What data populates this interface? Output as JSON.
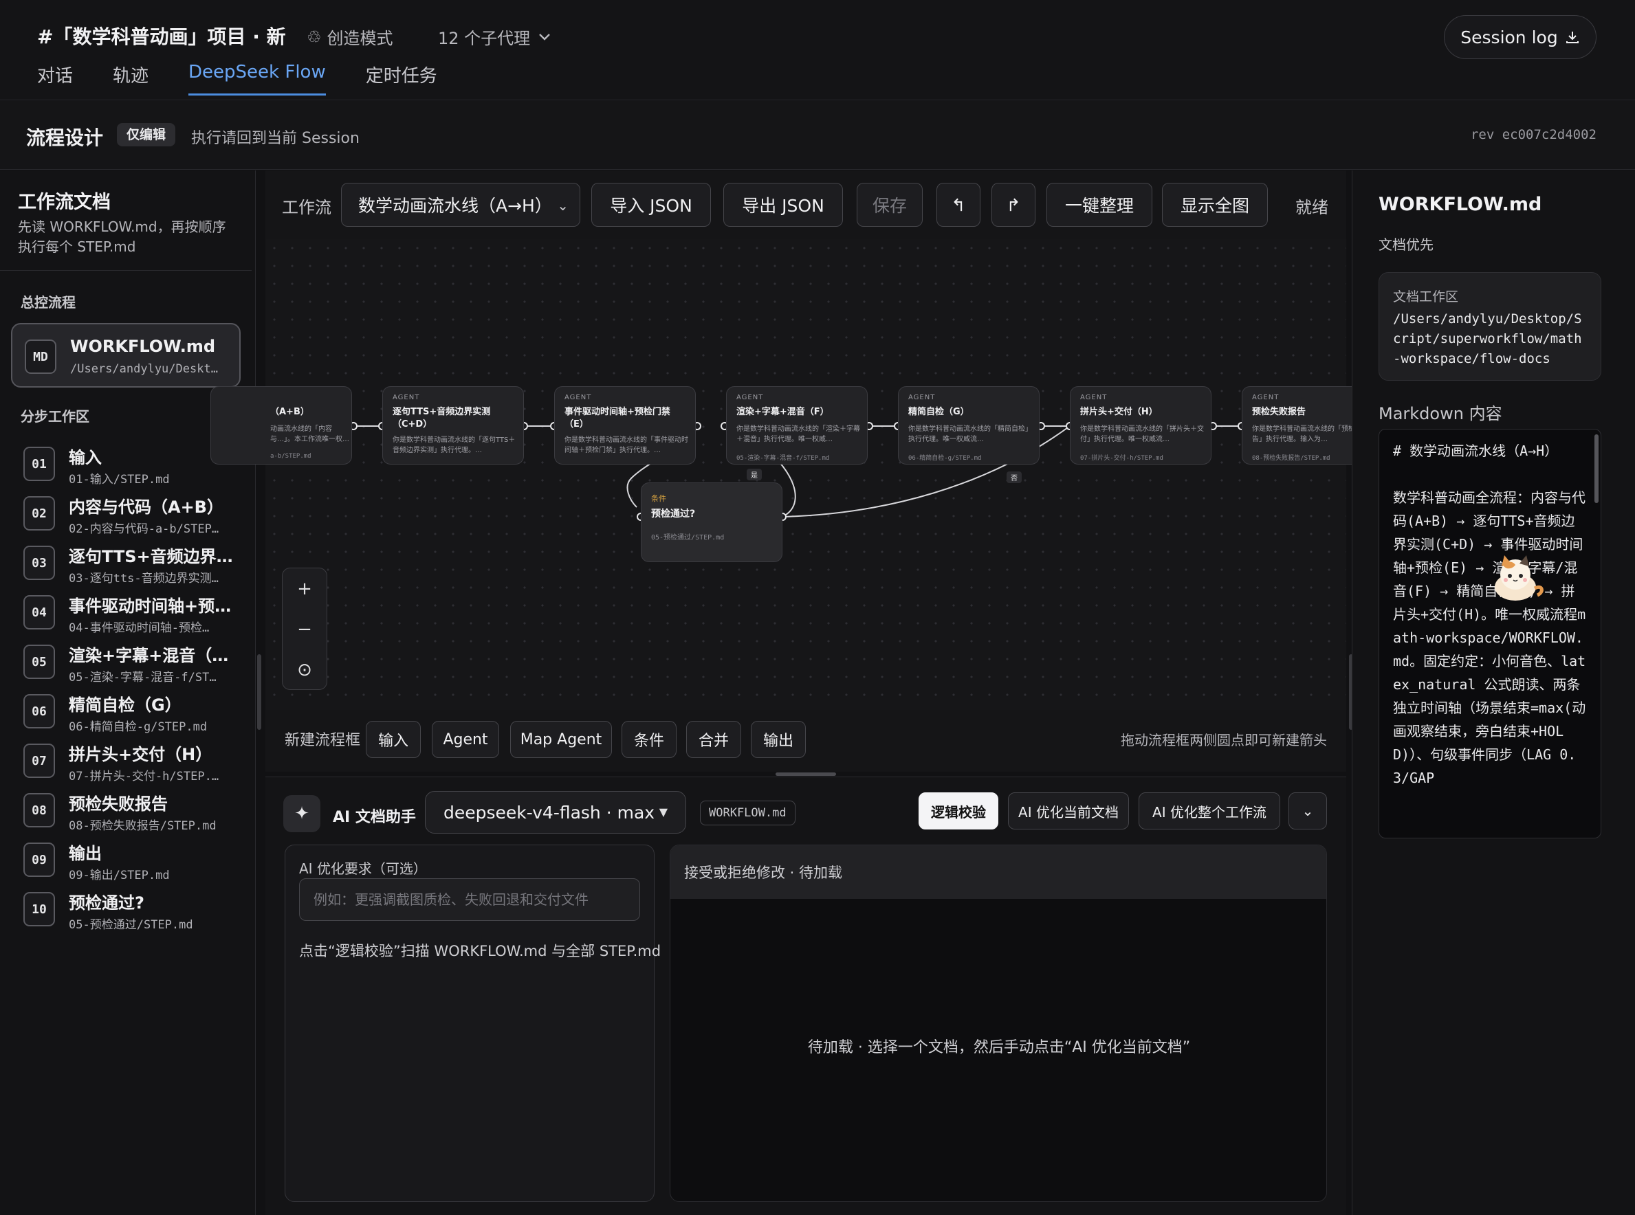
{
  "header": {
    "project_title": "#「数学科普动画」项目 · 新",
    "mode": "创造模式",
    "agents": "12 个子代理",
    "session_log": "Session log",
    "tabs": [
      {
        "label": "对话",
        "active": false
      },
      {
        "label": "轨迹",
        "active": false
      },
      {
        "label": "DeepSeek Flow",
        "active": true
      },
      {
        "label": "定时任务",
        "active": false
      }
    ]
  },
  "subheader": {
    "title": "流程设计",
    "badge": "仅编辑",
    "hint": "执行请回到当前 Session",
    "rev": "rev ec007c2d4002"
  },
  "sidebar": {
    "title": "工作流文档",
    "desc": "先读 WORKFLOW.md，再按顺序执行每个 STEP.md",
    "section_main": "总控流程",
    "main_item": {
      "badge": "MD",
      "name": "WORKFLOW.md",
      "path": "/Users/andylyu/Deskt…"
    },
    "section_steps": "分步工作区",
    "items": [
      {
        "num": "01",
        "name": "输入",
        "path": "01-输入/STEP.md"
      },
      {
        "num": "02",
        "name": "内容与代码（A+B）",
        "path": "02-内容与代码-a-b/STEP…"
      },
      {
        "num": "03",
        "name": "逐句TTS+音频边界…",
        "path": "03-逐句tts-音频边界实测…"
      },
      {
        "num": "04",
        "name": "事件驱动时间轴+预…",
        "path": "04-事件驱动时间轴-预检…"
      },
      {
        "num": "05",
        "name": "渲染+字幕+混音（…",
        "path": "05-渲染-字幕-混音-f/ST…"
      },
      {
        "num": "06",
        "name": "精简自检（G）",
        "path": "06-精简自检-g/STEP.md"
      },
      {
        "num": "07",
        "name": "拼片头+交付（H）",
        "path": "07-拼片头-交付-h/STEP.…"
      },
      {
        "num": "08",
        "name": "预检失败报告",
        "path": "08-预检失败报告/STEP.md"
      },
      {
        "num": "09",
        "name": "输出",
        "path": "09-输出/STEP.md"
      },
      {
        "num": "10",
        "name": "预检通过?",
        "path": "05-预检通过/STEP.md"
      }
    ]
  },
  "toolbar": {
    "label": "工作流",
    "workflow": "数学动画流水线（A→H）",
    "import": "导入 JSON",
    "export": "导出 JSON",
    "save": "保存",
    "undo": "↰",
    "redo": "↱",
    "arrange": "一键整理",
    "fit": "显示全图",
    "status": "就绪"
  },
  "canvas": {
    "nodes": [
      {
        "kind": "",
        "title": "（A+B）",
        "desc": "动画流水线的「内容与…」。本工作流唯一权…",
        "path": "a-b/STEP.md"
      },
      {
        "kind": "AGENT",
        "title": "逐句TTS+音频边界实测（C+D）",
        "desc": "你是数学科普动画流水线的「逐句TTS＋音频边界实测」执行代理。…",
        "path": ""
      },
      {
        "kind": "AGENT",
        "title": "事件驱动时间轴+预检门禁（E）",
        "desc": "你是数学科普动画流水线的「事件驱动时间轴＋预检门禁」执行代理。…",
        "path": ""
      },
      {
        "kind": "AGENT",
        "title": "渲染+字幕+混音（F）",
        "desc": "你是数学科普动画流水线的「渲染＋字幕＋混音」执行代理。唯一权威…",
        "path": "05-渲染-字幕-混音-f/STEP.md"
      },
      {
        "kind": "AGENT",
        "title": "精简自检（G）",
        "desc": "你是数学科普动画流水线的「精简自检」执行代理。唯一权威流…",
        "path": "06-精简自检-g/STEP.md"
      },
      {
        "kind": "AGENT",
        "title": "拼片头+交付（H）",
        "desc": "你是数学科普动画流水线的「拼片头＋交付」执行代理。唯一权威流…",
        "path": "07-拼片头-交付-h/STEP.md"
      },
      {
        "kind": "AGENT",
        "title": "预检失败报告",
        "desc": "你是数学科普动画流水线的「预检失败报告」执行代理。输入为…",
        "path": "08-预检失败报告/STEP.md"
      }
    ],
    "condition": {
      "kind": "条件",
      "title": "预检通过?",
      "path": "05-预检通过/STEP.md"
    },
    "edge_yes": "是",
    "edge_no": "否",
    "zoom_in": "+",
    "zoom_out": "−",
    "zoom_reset": "⊙"
  },
  "newbar": {
    "label": "新建流程框",
    "buttons": [
      "输入",
      "Agent",
      "Map Agent",
      "条件",
      "合并",
      "输出"
    ],
    "hint": "拖动流程框两侧圆点即可新建箭头"
  },
  "assistant": {
    "icon": "✦",
    "title": "AI 文档助手",
    "model": "deepseek-v4-flash · max",
    "file": "WORKFLOW.md",
    "check": "逻辑校验",
    "optimize_doc": "AI 优化当前文档",
    "optimize_all": "AI 优化整个工作流",
    "more": "⌄",
    "req_label": "AI 优化要求（可选）",
    "req_placeholder": "例如：更强调截图质检、失败回退和交付文件",
    "req_note": "点击“逻辑校验”扫描 WORKFLOW.md 与全部 STEP.md",
    "review_head": "接受或拒绝修改 · 待加载",
    "review_empty": "待加载 · 选择一个文档，然后手动点击“AI 优化当前文档”"
  },
  "rightpanel": {
    "title": "WORKFLOW.md",
    "sub": "文档优先",
    "workspace_label": "文档工作区",
    "workspace_path": "/Users/andylyu/Desktop/Script/superworkflow/math-workspace/flow-docs",
    "md_label": "Markdown 内容",
    "md_content": "# 数学动画流水线（A→H）\n\n数学科普动画全流程：内容与代码(A+B) → 逐句TTS+音频边界实测(C+D) → 事件驱动时间轴+预检(E) → 渲染/字幕/混音(F) → 精简自检(G) → 拼片头+交付(H)。唯一权威流程math-workspace/WORKFLOW.md。固定约定：小何音色、latex_natural 公式朗读、两条独立时间轴（场景结束=max(动画观察结束，旁白结束+HOLD)）、句级事件同步（LAG 0.3/GAP"
  },
  "colors": {
    "accent": "#4c8de0",
    "background": "#111113",
    "condition": "#d9a441"
  }
}
